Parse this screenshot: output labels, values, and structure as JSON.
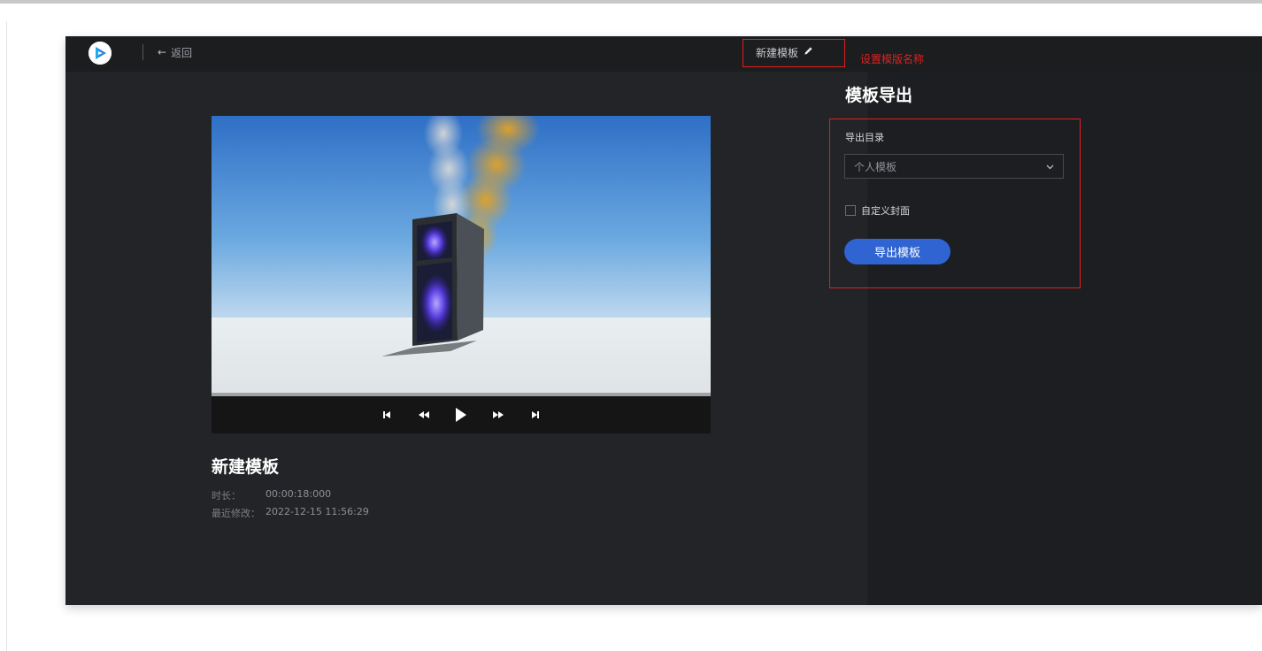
{
  "header": {
    "back_label": "返回",
    "template_name": "新建模板",
    "annotation_set_name": "设置模版名称"
  },
  "preview": {
    "template_title": "新建模板",
    "duration_label": "时长：",
    "duration_value": "00:00:18:000",
    "modified_label": "最近修改：",
    "modified_value": "2022-12-15 11:56:29"
  },
  "export_panel": {
    "title": "模板导出",
    "dir_label": "导出目录",
    "dir_selected": "个人模板",
    "custom_cover_label": "自定义封面",
    "custom_cover_checked": false,
    "export_button_label": "导出模板"
  },
  "icons": {
    "logo": "app-logo-icon",
    "back": "arrow-left-icon",
    "edit": "pencil-icon",
    "dropdown": "chevron-down-icon",
    "controls": [
      "skip-start-icon",
      "rewind-icon",
      "play-icon",
      "fast-forward-icon",
      "skip-end-icon"
    ]
  },
  "colors": {
    "accent": "#2f64d2",
    "annotation": "#e02020",
    "background": "#232427",
    "panel": "#1d1e21"
  }
}
